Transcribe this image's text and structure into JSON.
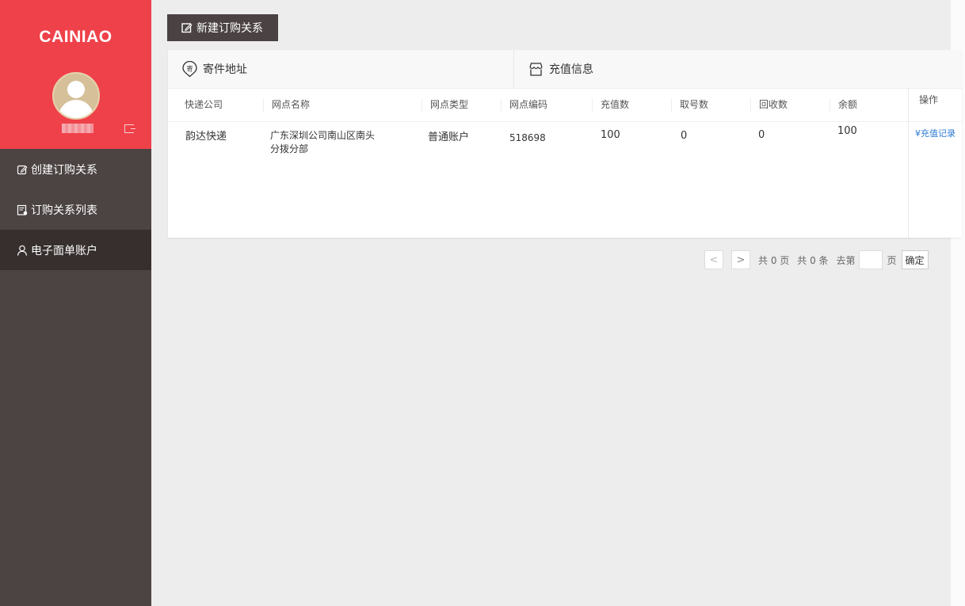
{
  "sidebar": {
    "logo": "CAINIAO",
    "nav": [
      {
        "label": "创建订购关系",
        "icon": "edit-icon"
      },
      {
        "label": "订购关系列表",
        "icon": "list-icon"
      },
      {
        "label": "电子面单账户",
        "icon": "user-icon"
      }
    ],
    "active_index": 2
  },
  "toolbar": {
    "new_button_label": "新建订购关系"
  },
  "panel": {
    "tabs": [
      {
        "label": "寄件地址",
        "icon": "address-pin-icon"
      },
      {
        "label": "充值信息",
        "icon": "shop-icon"
      }
    ],
    "columns": [
      "快递公司",
      "网点名称",
      "网点类型",
      "网点编码",
      "充值数",
      "取号数",
      "回收数",
      "余额",
      "操作"
    ],
    "rows": [
      {
        "company": "韵达快递",
        "branch_name_line1": "广东深圳公司南山区南头",
        "branch_name_line2": "分拨分部",
        "branch_type": "普通账户",
        "branch_code": "518698",
        "recharge": "100",
        "taken": "0",
        "recycled": "0",
        "balance": "100",
        "action": "¥充值记录"
      }
    ]
  },
  "pagination": {
    "prev": "<",
    "next": ">",
    "total_pages_text": "共 0 页",
    "total_items_text": "共 0 条",
    "goto_label": "去第",
    "page_suffix": "页",
    "confirm_label": "确定",
    "input_value": ""
  }
}
